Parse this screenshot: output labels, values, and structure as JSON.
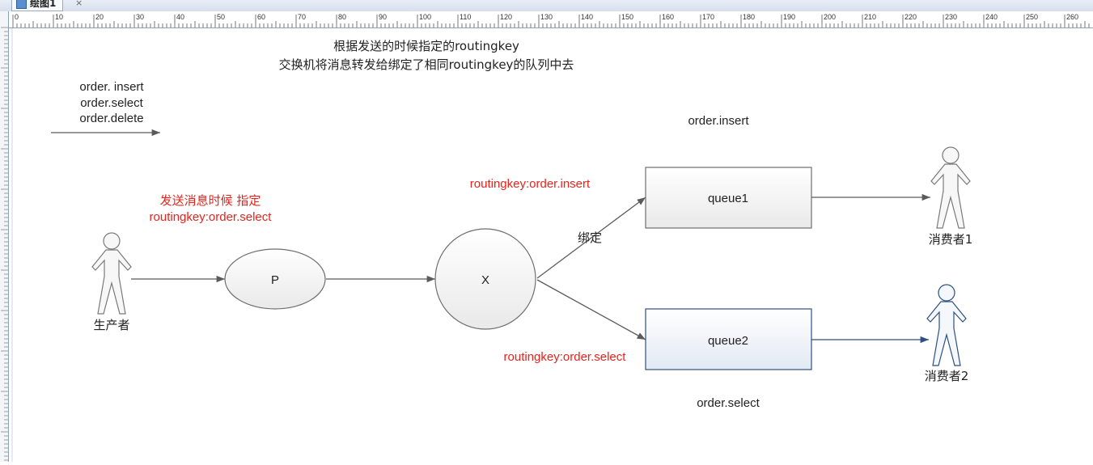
{
  "window": {
    "tab_title": "绘图1",
    "tab_close": "×"
  },
  "ruler": {
    "labels": [
      "0",
      "10",
      "20",
      "30",
      "40",
      "50",
      "60",
      "70",
      "80",
      "90",
      "100",
      "110",
      "120",
      "130",
      "140",
      "150",
      "160",
      "170",
      "180",
      "190",
      "200",
      "210",
      "220",
      "230",
      "240",
      "250",
      "260"
    ]
  },
  "notes": {
    "line1": "根据发送的时候指定的routingkey",
    "line2": "交换机将消息转发给绑定了相同routingkey的队列中去"
  },
  "legend": {
    "lines": [
      "order. insert",
      "order.select",
      "order.delete"
    ]
  },
  "producer": {
    "label": "生产者",
    "note_line1": "发送消息时候  指定",
    "note_line2": "routingkey:order.select"
  },
  "nodes": {
    "p_label": "P",
    "x_label": "X",
    "queue1": "queue1",
    "queue2": "queue2"
  },
  "edges": {
    "bind_label": "绑定",
    "routing_insert": "routingkey:order.insert",
    "routing_select": "routingkey:order.select"
  },
  "queue_captions": {
    "top": "order.insert",
    "bottom": "order.select"
  },
  "consumers": {
    "c1": "消费者1",
    "c2": "消费者2"
  },
  "colors": {
    "red_text": "#e8231c",
    "line": "#5b5b5b",
    "queue2_border": "#2e4f7f"
  }
}
